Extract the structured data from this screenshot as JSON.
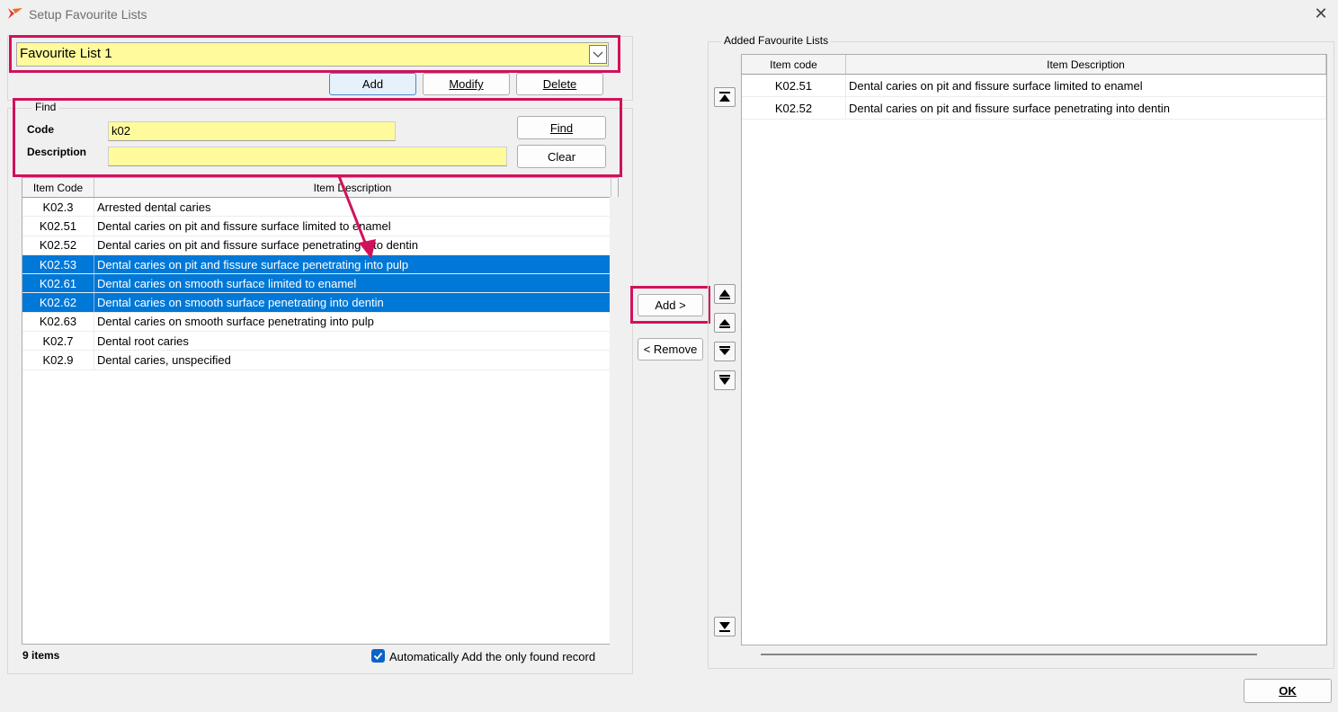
{
  "window": {
    "title": "Setup Favourite Lists",
    "close_label": "✕"
  },
  "favourites": {
    "selected_list": "Favourite List 1",
    "add_label": "Add",
    "modify_label": "Modify",
    "delete_label": "Delete"
  },
  "find": {
    "group_label": "Find",
    "code_label": "Code",
    "code_value": "k02",
    "description_label": "Description",
    "description_value": "",
    "find_label": "Find",
    "clear_label": "Clear"
  },
  "results": {
    "columns": [
      "Item Code",
      "Item Description"
    ],
    "rows": [
      {
        "code": "K02.3",
        "desc": "Arrested dental caries",
        "selected": false
      },
      {
        "code": "K02.51",
        "desc": "Dental caries on pit and fissure surface limited to enamel",
        "selected": false
      },
      {
        "code": "K02.52",
        "desc": "Dental caries on pit and fissure surface penetrating into dentin",
        "selected": false
      },
      {
        "code": "K02.53",
        "desc": "Dental caries on pit and fissure surface penetrating into pulp",
        "selected": true
      },
      {
        "code": "K02.61",
        "desc": "Dental caries on smooth surface limited to enamel",
        "selected": true
      },
      {
        "code": "K02.62",
        "desc": "Dental caries on smooth surface penetrating into dentin",
        "selected": true
      },
      {
        "code": "K02.63",
        "desc": "Dental caries on smooth surface penetrating into pulp",
        "selected": false
      },
      {
        "code": "K02.7",
        "desc": "Dental root caries",
        "selected": false
      },
      {
        "code": "K02.9",
        "desc": "Dental caries, unspecified",
        "selected": false
      }
    ],
    "count_label": "9 items",
    "auto_add_label": "Automatically Add the only found record",
    "auto_add_checked": true
  },
  "transfer": {
    "add_label": "Add >",
    "remove_label": "< Remove"
  },
  "added": {
    "group_label": "Added Favourite Lists",
    "columns": [
      "Item code",
      "Item Description"
    ],
    "rows": [
      {
        "code": "K02.51",
        "desc": "Dental caries on pit and fissure surface limited to enamel"
      },
      {
        "code": "K02.52",
        "desc": "Dental caries on pit and fissure surface penetrating into dentin"
      }
    ]
  },
  "footer": {
    "ok_label": "OK"
  },
  "colors": {
    "highlight": "#d1115c",
    "selection": "#0078d7",
    "input_bg": "#fffb9c"
  }
}
